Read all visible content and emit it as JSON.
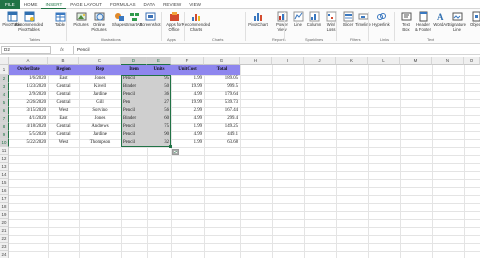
{
  "ribbon_tabs": [
    "FILE",
    "HOME",
    "INSERT",
    "PAGE LAYOUT",
    "FORMULAS",
    "DATA",
    "REVIEW",
    "VIEW"
  ],
  "active_tab": "INSERT",
  "ribbon": {
    "buttons": [
      {
        "label": "PivotTable",
        "icon": "pivottable-icon",
        "color": "#2f6fb0"
      },
      {
        "label": "Recommended\nPivotTables",
        "icon": "recommended-pivot-icon",
        "color": "#2f6fb0"
      },
      {
        "label": "Table",
        "icon": "table-icon",
        "color": "#3a78c0"
      },
      {
        "label": "Pictures",
        "icon": "pictures-icon",
        "color": "#4a8a3a"
      },
      {
        "label": "Online\nPictures",
        "icon": "online-pictures-icon",
        "color": "#3b7dc4"
      },
      {
        "label": "Shapes",
        "icon": "shapes-icon",
        "color": "#e08a2c"
      },
      {
        "label": "SmartArt",
        "icon": "smartart-icon",
        "color": "#2f9a4c"
      },
      {
        "label": "Screenshot",
        "icon": "screenshot-icon",
        "color": "#3a6fb4"
      },
      {
        "label": "Apps for\nOffice",
        "icon": "apps-icon",
        "color": "#d44b2f"
      },
      {
        "label": "Recommended\nCharts",
        "icon": "recommended-charts-icon",
        "color": "#3a78c0"
      },
      {
        "label": "PivotChart",
        "icon": "pivotchart-icon",
        "color": "#3a78c0"
      },
      {
        "label": "Power\nView",
        "icon": "power-view-icon",
        "color": "#c0392b"
      },
      {
        "label": "Line",
        "icon": "sparkline-line-icon",
        "color": "#3a78c0"
      },
      {
        "label": "Column",
        "icon": "sparkline-column-icon",
        "color": "#3a78c0"
      },
      {
        "label": "Win/\nLoss",
        "icon": "sparkline-winloss-icon",
        "color": "#3a78c0"
      },
      {
        "label": "Slicer",
        "icon": "slicer-icon",
        "color": "#3a78c0"
      },
      {
        "label": "Timeline",
        "icon": "timeline-icon",
        "color": "#3a78c0"
      },
      {
        "label": "Hyperlink",
        "icon": "hyperlink-icon",
        "color": "#3a78c0"
      },
      {
        "label": "Text\nBox",
        "icon": "text-box-icon",
        "color": "#555555"
      },
      {
        "label": "Header\n& Footer",
        "icon": "header-footer-icon",
        "color": "#555555"
      },
      {
        "label": "WordArt",
        "icon": "wordart-icon",
        "color": "#2f6fb0"
      },
      {
        "label": "Signature\nLine",
        "icon": "signature-line-icon",
        "color": "#555555"
      },
      {
        "label": "Object",
        "icon": "object-icon",
        "color": "#555555"
      }
    ],
    "groups": [
      "Tables",
      "Illustrations",
      "Apps",
      "Charts",
      "Reports",
      "Sparklines",
      "Filters",
      "Links",
      "Text"
    ]
  },
  "formula_bar": {
    "name_box": "D2",
    "fx": "fx",
    "value": "Pencil"
  },
  "columns": [
    "A",
    "B",
    "C",
    "D",
    "E",
    "F",
    "G",
    "H",
    "I",
    "J",
    "K",
    "L",
    "M",
    "N",
    "O"
  ],
  "rows": [
    "1",
    "2",
    "3",
    "4",
    "5",
    "6",
    "7",
    "8",
    "9",
    "10",
    "11",
    "12",
    "13",
    "14",
    "15",
    "16",
    "17",
    "18",
    "19",
    "20",
    "21",
    "22",
    "23",
    "24"
  ],
  "table": {
    "headers": [
      "OrderDate",
      "Region",
      "Rep",
      "Item",
      "Units",
      "UnitCost",
      "Total"
    ],
    "rows": [
      [
        "1/6/2020",
        "East",
        "Jones",
        "Pencil",
        "95",
        "1.99",
        "189.05"
      ],
      [
        "1/23/2020",
        "Central",
        "Kivell",
        "Binder",
        "50",
        "19.99",
        "999.5"
      ],
      [
        "2/9/2020",
        "Central",
        "Jardine",
        "Pencil",
        "36",
        "4.99",
        "179.64"
      ],
      [
        "2/26/2020",
        "Central",
        "Gill",
        "Pen",
        "27",
        "19.99",
        "539.73"
      ],
      [
        "3/15/2020",
        "West",
        "Sorvino",
        "Pencil",
        "56",
        "2.99",
        "167.44"
      ],
      [
        "4/1/2020",
        "East",
        "Jones",
        "Binder",
        "60",
        "4.99",
        "299.4"
      ],
      [
        "4/18/2020",
        "Central",
        "Andrews",
        "Pencil",
        "75",
        "1.99",
        "149.25"
      ],
      [
        "5/5/2020",
        "Central",
        "Jardine",
        "Pencil",
        "90",
        "4.99",
        "449.1"
      ],
      [
        "5/22/2020",
        "West",
        "Thompson",
        "Pencil",
        "32",
        "1.99",
        "63.68"
      ]
    ]
  },
  "quick_analysis_label": "quick-analysis",
  "colors": {
    "header_fill": "#8e86ee",
    "excel_green": "#217346",
    "selection_fill": "#cfcfcf"
  }
}
